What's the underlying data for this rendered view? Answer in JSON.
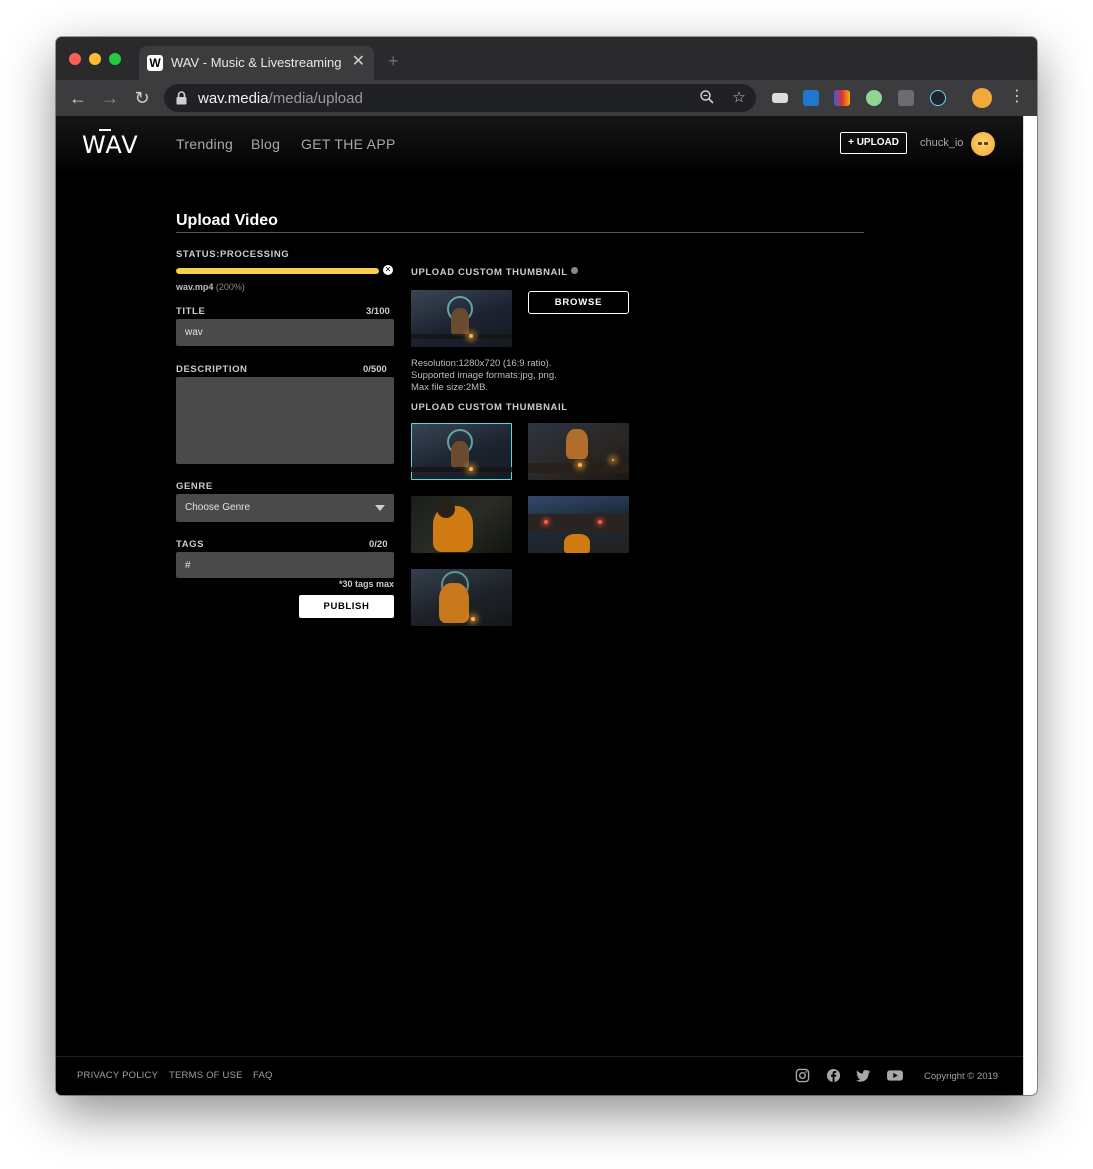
{
  "browser": {
    "tab_title": "WAV - Music & Livestreaming",
    "tab_favicon_letter": "W",
    "url_host": "wav.media",
    "url_path": "/media/upload"
  },
  "header": {
    "logo": "WAV",
    "nav": [
      "Trending",
      "Blog",
      "GET THE APP"
    ],
    "upload_label": "+ UPLOAD",
    "username": "chuck_io"
  },
  "upload": {
    "page_title": "Upload Video",
    "status_label": "STATUS:PROCESSING",
    "progress_percent": 200,
    "file_name": "wav.mp4",
    "file_progress_text": "(200%)",
    "title_label": "TITLE",
    "title_counter": "3/100",
    "title_value": "wav",
    "description_label": "DESCRIPTION",
    "description_counter": "0/500",
    "description_value": "",
    "genre_label": "GENRE",
    "genre_selected": "Choose Genre",
    "tags_label": "TAGS",
    "tags_counter": "0/20",
    "tags_value": "#",
    "tags_note": "*30 tags max",
    "publish_label": "PUBLISH"
  },
  "thumbnail": {
    "custom_heading": "UPLOAD CUSTOM THUMBNAIL",
    "browse_label": "BROWSE",
    "spec_resolution": "Resolution:1280x720 (16:9 ratio).",
    "spec_formats": "Supported image formats:jpg, png.",
    "spec_size": "Max file size:2MB.",
    "generated_heading": "UPLOAD CUSTOM THUMBNAIL",
    "selected_index": 0,
    "count": 5
  },
  "footer": {
    "links": [
      "PRIVACY POLICY",
      "TERMS OF USE",
      "FAQ"
    ],
    "social_icons": [
      "instagram-icon",
      "facebook-icon",
      "twitter-icon",
      "youtube-icon"
    ],
    "copyright": "Copyright © 2019"
  },
  "colors": {
    "progress": "#f7d14b",
    "selected_outline": "#5ad6d6",
    "field_bg": "#4a4a4a"
  }
}
